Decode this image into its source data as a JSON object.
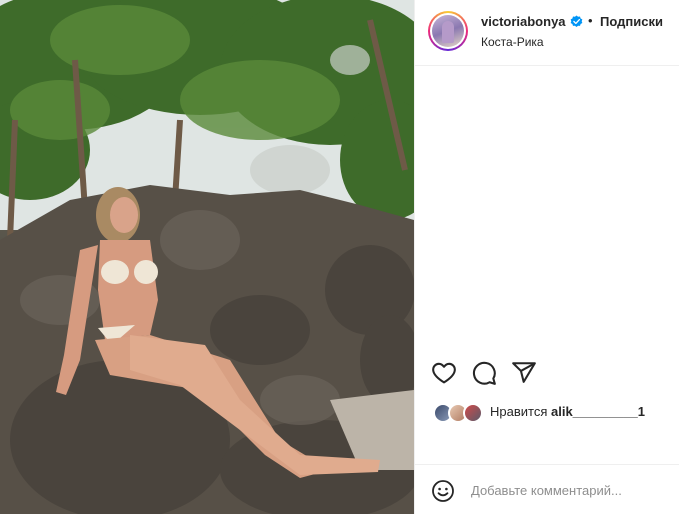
{
  "post": {
    "photo_alt": "",
    "author": {
      "username": "victoriabonya",
      "verified": true,
      "location": "Коста-Рика"
    },
    "separator": "•",
    "follow_label": "Подписки",
    "actions": {
      "like_icon": "heart-icon",
      "comment_icon": "comment-icon",
      "share_icon": "share-icon"
    },
    "likes": {
      "prefix": "Нравится",
      "user": "alik_________1"
    },
    "comment": {
      "emoji_icon": "smiley-icon",
      "placeholder": "Добавьте комментарий..."
    }
  },
  "colors": {
    "text": "#262626",
    "secondary": "#8e8e8e",
    "verified": "#0095f6",
    "border": "#efefef"
  }
}
